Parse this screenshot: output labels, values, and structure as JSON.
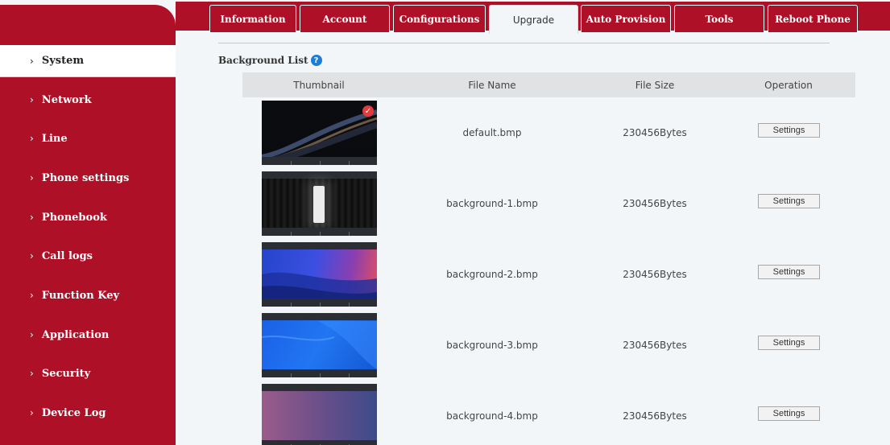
{
  "tabs": [
    {
      "label": "Information"
    },
    {
      "label": "Account"
    },
    {
      "label": "Configurations"
    },
    {
      "label": "Upgrade"
    },
    {
      "label": "Auto Provision"
    },
    {
      "label": "Tools"
    },
    {
      "label": "Reboot Phone"
    }
  ],
  "active_tab": "Upgrade",
  "sidebar": {
    "items": [
      {
        "label": "System"
      },
      {
        "label": "Network"
      },
      {
        "label": "Line"
      },
      {
        "label": "Phone settings"
      },
      {
        "label": "Phonebook"
      },
      {
        "label": "Call logs"
      },
      {
        "label": "Function Key"
      },
      {
        "label": "Application"
      },
      {
        "label": "Security"
      },
      {
        "label": "Device Log"
      }
    ],
    "active": "System"
  },
  "section": {
    "title": "Background List",
    "help_icon": "question-icon"
  },
  "table": {
    "headers": [
      "Thumbnail",
      "File Name",
      "File Size",
      "Operation"
    ],
    "rows": [
      {
        "file_name": "default.bmp",
        "file_size": "230456Bytes",
        "operation": "Settings",
        "selected": true
      },
      {
        "file_name": "background-1.bmp",
        "file_size": "230456Bytes",
        "operation": "Settings"
      },
      {
        "file_name": "background-2.bmp",
        "file_size": "230456Bytes",
        "operation": "Settings"
      },
      {
        "file_name": "background-3.bmp",
        "file_size": "230456Bytes",
        "operation": "Settings"
      },
      {
        "file_name": "background-4.bmp",
        "file_size": "230456Bytes",
        "operation": "Settings"
      }
    ]
  },
  "colors": {
    "brand": "#ae1127",
    "background": "#f3f6f8",
    "header_row": "#e0e2e3",
    "help_icon": "#1e7bd6",
    "check": "#e23b3b"
  }
}
